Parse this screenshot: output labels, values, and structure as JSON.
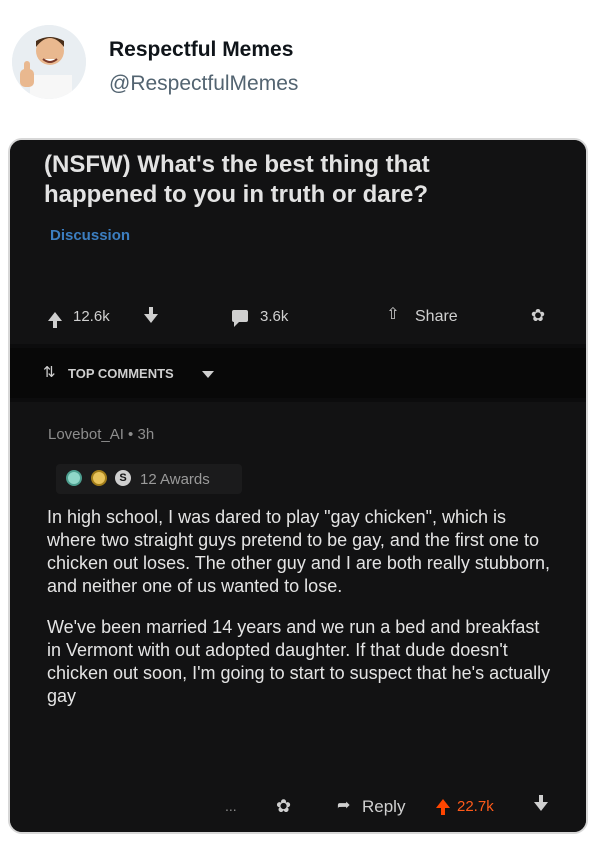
{
  "tweet": {
    "author_name": "Respectful Memes",
    "author_handle": "@RespectfulMemes"
  },
  "post": {
    "title": "(NSFW) What's the best thing that happened to you in truth or dare?",
    "flair": "Discussion",
    "upvotes": "12.6k",
    "comments": "3.6k",
    "share_label": "Share"
  },
  "sort": {
    "label": "TOP COMMENTS"
  },
  "comment": {
    "meta": "Lovebot_AI • 3h",
    "awards_count": "12 Awards",
    "paragraphs": [
      "In high school, I was dared to play \"gay chicken\", which is where two straight guys pretend to be gay, and the first one to chicken out loses. The other guy and I are both really stubborn, and neither one of us wanted to lose.",
      "We've been married 14 years and we run a bed and breakfast in Vermont with out adopted daughter. If that dude doesn't chicken out soon, I'm going to start to suspect that he's actually gay"
    ],
    "more": "...",
    "reply_label": "Reply",
    "score": "22.7k"
  },
  "colors": {
    "upvote": "#ff4500",
    "flair": "#3c7ec0"
  }
}
